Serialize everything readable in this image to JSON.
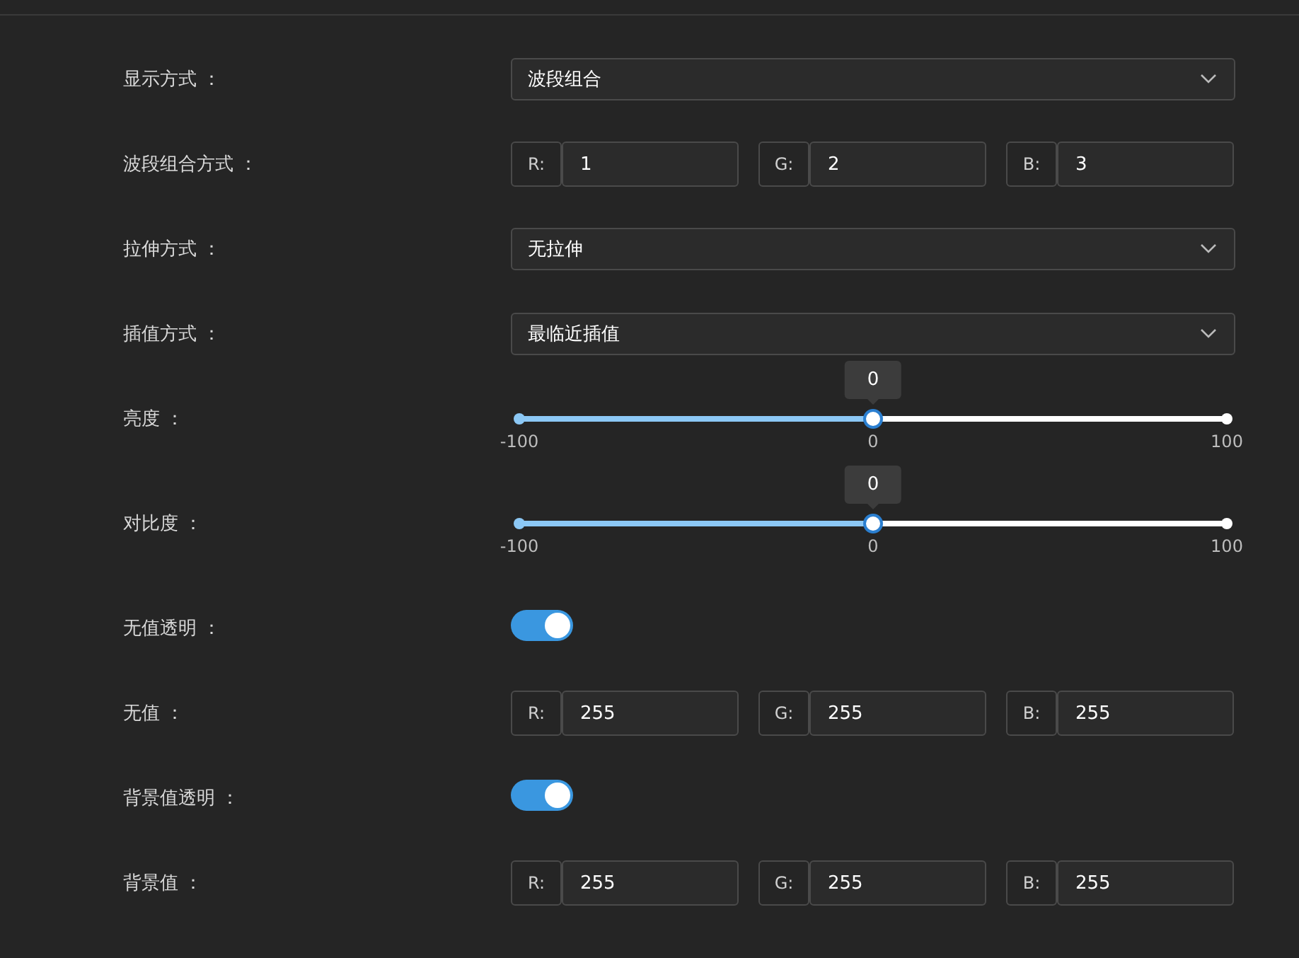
{
  "rows": [
    {
      "kind": "select",
      "label": "显示方式 ：",
      "value": "波段组合"
    },
    {
      "kind": "rgb",
      "label": "波段组合方式 ：",
      "channels": [
        {
          "name": "R:",
          "value": "1"
        },
        {
          "name": "G:",
          "value": "2"
        },
        {
          "name": "B:",
          "value": "3"
        }
      ]
    },
    {
      "kind": "select",
      "label": "拉伸方式 ：",
      "value": "无拉伸"
    },
    {
      "kind": "select",
      "label": "插值方式 ：",
      "value": "最临近插值"
    },
    {
      "kind": "slider",
      "label": "亮度 ：",
      "tooltip": "0",
      "level": 0.5,
      "min_label": "-100",
      "mid_label": "0",
      "max_label": "100"
    },
    {
      "kind": "slider",
      "label": "对比度 ：",
      "tooltip": "0",
      "level": 0.5,
      "min_label": "-100",
      "mid_label": "0",
      "max_label": "100"
    },
    {
      "kind": "switch",
      "label": "无值透明 ：",
      "on": true
    },
    {
      "kind": "rgb",
      "label": "无值 ：",
      "channels": [
        {
          "name": "R:",
          "value": "255"
        },
        {
          "name": "G:",
          "value": "255"
        },
        {
          "name": "B:",
          "value": "255"
        }
      ]
    },
    {
      "kind": "switch",
      "label": "背景值透明 ：",
      "on": true
    },
    {
      "kind": "rgb",
      "label": "背景值 ：",
      "channels": [
        {
          "name": "R:",
          "value": "255"
        },
        {
          "name": "G:",
          "value": "255"
        },
        {
          "name": "B:",
          "value": "255"
        }
      ]
    }
  ]
}
